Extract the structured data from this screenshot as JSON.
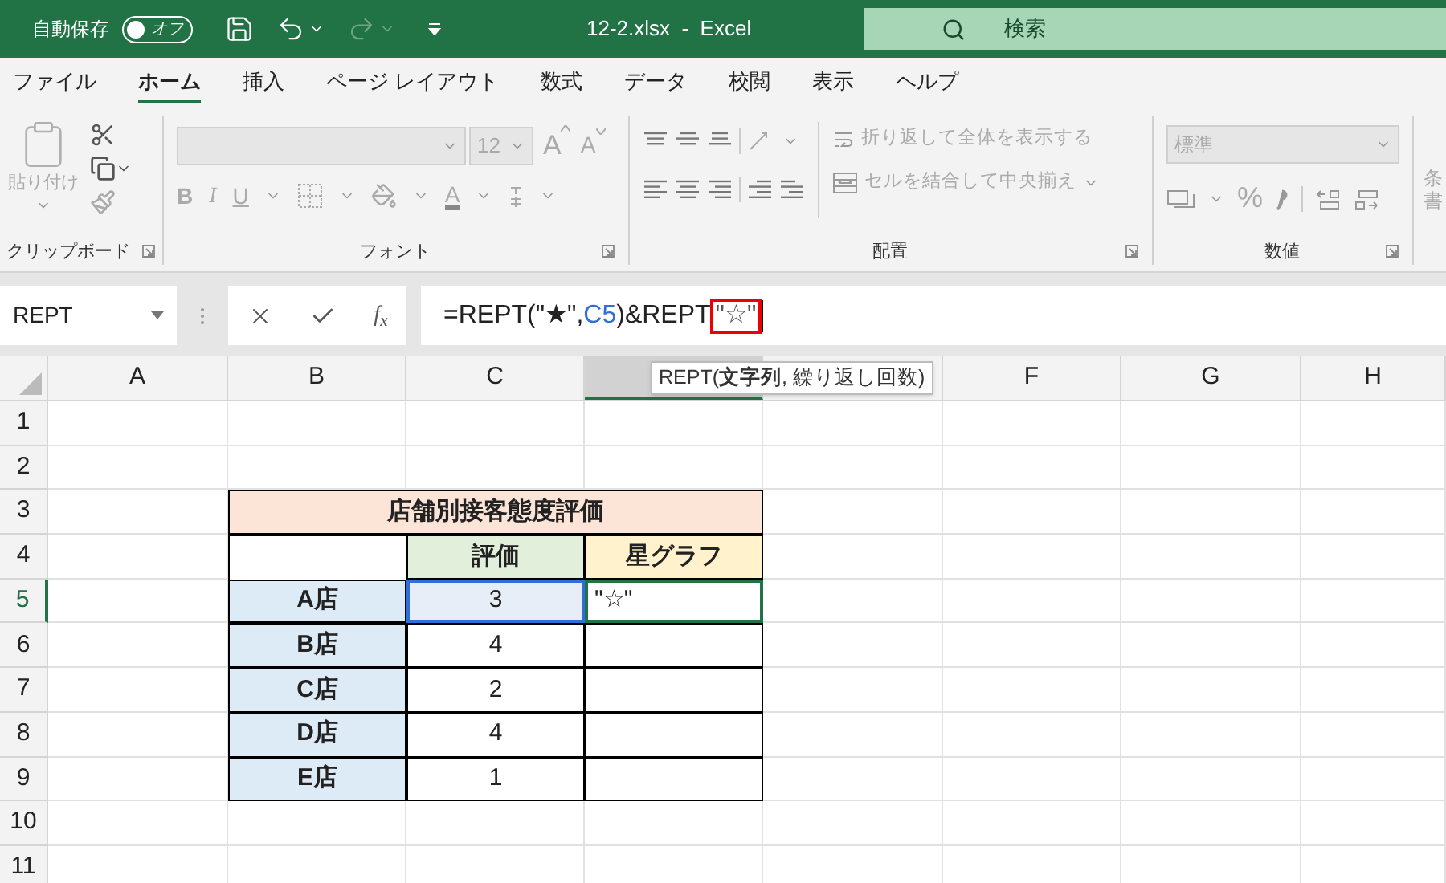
{
  "title_bar": {
    "autosave_label": "自動保存",
    "autosave_toggle": {
      "label": "オフ",
      "on": false
    },
    "title": "12-2.xlsx  -  Excel",
    "search": {
      "placeholder": "検索"
    }
  },
  "menu_tabs": [
    {
      "label": "ファイル",
      "selected": false
    },
    {
      "label": "ホーム",
      "selected": true
    },
    {
      "label": "挿入",
      "selected": false
    },
    {
      "label": "ページ レイアウト",
      "selected": false
    },
    {
      "label": "数式",
      "selected": false
    },
    {
      "label": "データ",
      "selected": false
    },
    {
      "label": "校閲",
      "selected": false
    },
    {
      "label": "表示",
      "selected": false
    },
    {
      "label": "ヘルプ",
      "selected": false
    }
  ],
  "ribbon": {
    "clipboard": {
      "paste_label": "貼り付け",
      "group_label": "クリップボード"
    },
    "font": {
      "font_size": "12",
      "grow": "A",
      "shrink": "A",
      "bold": "B",
      "italic": "I",
      "underline": "U",
      "font_color": "A",
      "group_label": "フォント"
    },
    "alignment": {
      "wrap_text": "折り返して全体を表示する",
      "merge_center": "セルを結合して中央揃え",
      "group_label": "配置"
    },
    "number": {
      "format": "標準",
      "percent": "%",
      "group_label": "数値"
    },
    "cut_off_group": [
      "条",
      "書"
    ]
  },
  "formula_bar": {
    "name_box": "REPT",
    "function_button": "f$_{x}$",
    "formula": [
      {
        "kind": "plain",
        "text": "=REPT(\"★\","
      },
      {
        "kind": "ref",
        "text": "C5"
      },
      {
        "kind": "plain",
        "text": ")&REPT"
      },
      {
        "kind": "highlight",
        "text": "\"☆\""
      }
    ],
    "tooltip": "REPT(**文字列**, 繰り返し回数)"
  },
  "sheet": {
    "columns": [
      {
        "label": "A",
        "selected": false
      },
      {
        "label": "B",
        "selected": false
      },
      {
        "label": "C",
        "selected": false
      },
      {
        "selected": true
      },
      {
        "selected": false
      },
      {
        "label": "F",
        "selected": false
      },
      {
        "label": "G",
        "selected": false
      },
      {
        "label": "H",
        "selected": false
      }
    ],
    "rows": [
      {
        "label": "1",
        "selected": false
      },
      {
        "label": "2",
        "selected": false
      },
      {
        "label": "3",
        "selected": false
      },
      {
        "label": "4",
        "selected": false
      },
      {
        "label": "5",
        "selected": true
      },
      {
        "label": "6",
        "selected": false
      },
      {
        "label": "7",
        "selected": false
      },
      {
        "label": "8",
        "selected": false
      },
      {
        "label": "9",
        "selected": false
      },
      {
        "label": "10",
        "selected": false
      },
      {
        "label": "11",
        "selected": false
      }
    ],
    "table": {
      "title": "店舗別接客態度評価",
      "headers": [
        "評価",
        "星グラフ"
      ],
      "rows": [
        {
          "store": "A店",
          "score": "3",
          "score_referenced": true,
          "graph": "\"☆\"",
          "graph_active": true
        },
        {
          "store": "B店",
          "score": "4",
          "score_referenced": false,
          "graph_active": false
        },
        {
          "store": "C店",
          "score": "2",
          "score_referenced": false,
          "graph_active": false
        },
        {
          "store": "D店",
          "score": "4",
          "score_referenced": false,
          "graph_active": false
        },
        {
          "store": "E店",
          "score": "1",
          "score_referenced": false,
          "graph_active": false
        }
      ]
    }
  }
}
